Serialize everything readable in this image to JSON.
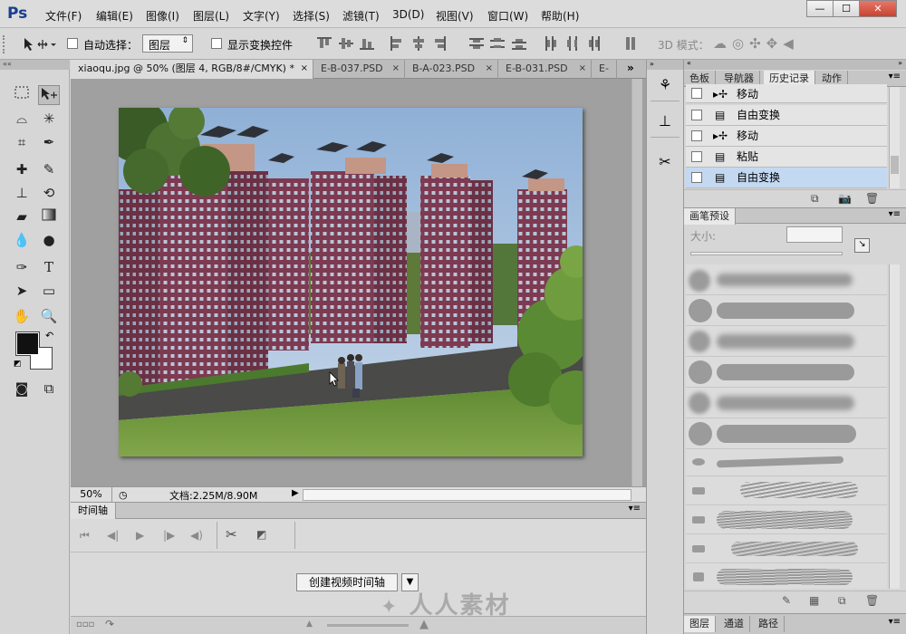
{
  "app": {
    "logo": "Ps"
  },
  "menu": [
    "文件(F)",
    "编辑(E)",
    "图像(I)",
    "图层(L)",
    "文字(Y)",
    "选择(S)",
    "滤镜(T)",
    "3D(D)",
    "视图(V)",
    "窗口(W)",
    "帮助(H)"
  ],
  "window_controls": {
    "minimize": "—",
    "maximize": "☐",
    "close": "✕"
  },
  "options": {
    "auto_select_label": "自动选择：",
    "auto_select_value": "图层",
    "transform_controls_label": "显示变换控件",
    "mode_3d_label": "3D 模式："
  },
  "tabs": [
    {
      "label": "xiaoqu.jpg @ 50% (图层 4, RGB/8#/CMYK) *",
      "active": true
    },
    {
      "label": "E-B-037.PSD",
      "active": false
    },
    {
      "label": "B-A-023.PSD",
      "active": false
    },
    {
      "label": "E-B-031.PSD",
      "active": false
    },
    {
      "label": "E-",
      "active": false
    }
  ],
  "status": {
    "zoom": "50%",
    "doc_info": "文档:2.25M/8.90M"
  },
  "timeline": {
    "tab_label": "时间轴",
    "create_button": "创建视频时间轴"
  },
  "panels": {
    "top_tabs": [
      "色板",
      "导航器",
      "历史记录",
      "动作"
    ],
    "active_tab": "历史记录",
    "history": [
      {
        "label": "移动",
        "icon": "move-icon",
        "active": false
      },
      {
        "label": "自由变换",
        "icon": "document-icon",
        "active": false
      },
      {
        "label": "移动",
        "icon": "move-icon",
        "active": false
      },
      {
        "label": "粘贴",
        "icon": "document-icon",
        "active": false
      },
      {
        "label": "自由变换",
        "icon": "document-icon",
        "active": true
      }
    ],
    "brush_presets": {
      "tab_label": "画笔预设",
      "size_label": "大小:"
    },
    "bottom_tabs": [
      "图层",
      "通道",
      "路径"
    ]
  },
  "watermark": "人人素材",
  "colors": {
    "menubar_bg": "#dcdcdc",
    "canvas_sky": "#9bb8d8",
    "building": "#7e3b52",
    "grass": "#6f9a3a",
    "history_highlight": "#c3d8f1"
  }
}
